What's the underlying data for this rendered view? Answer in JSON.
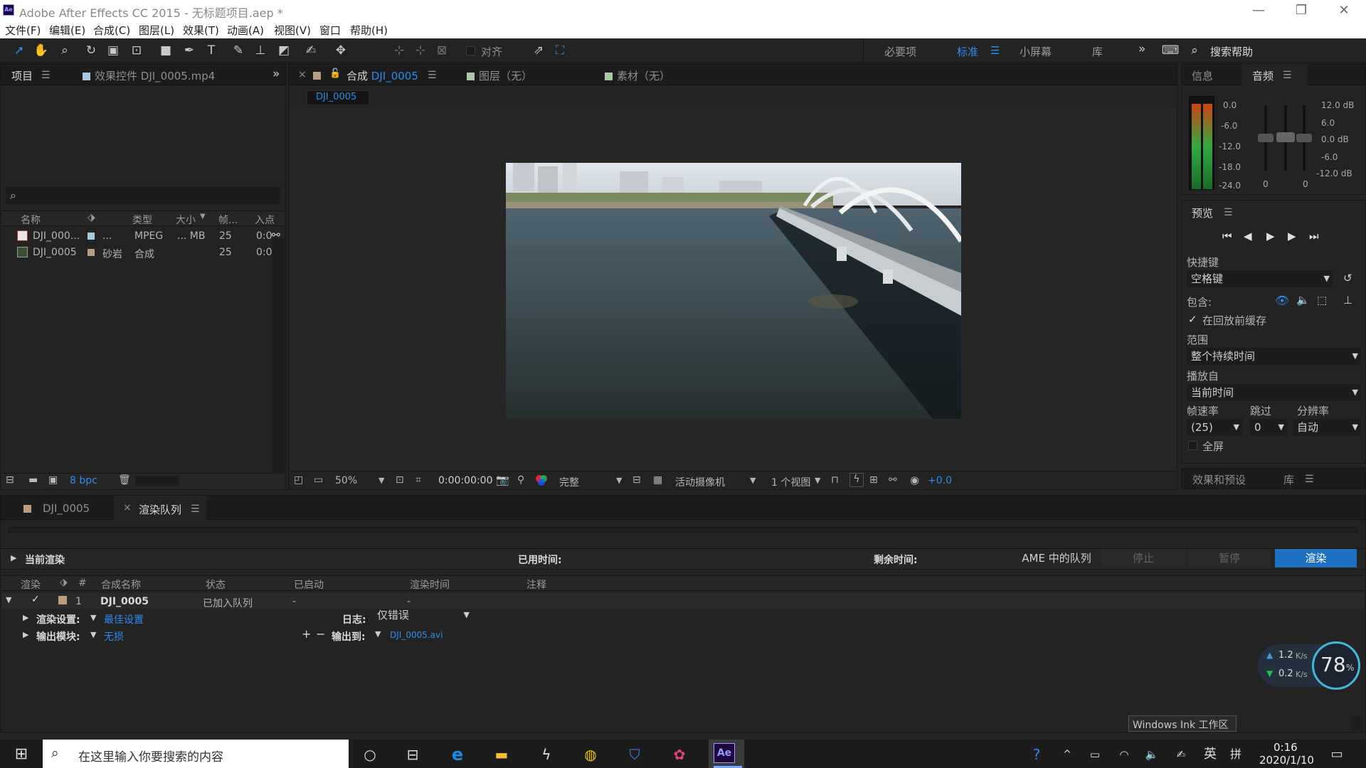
{
  "window": {
    "app_icon": "Ae",
    "title": "Adobe After Effects CC 2015 - 无标题项目.aep *",
    "minimize": "—",
    "restore": "❐",
    "close": "✕"
  },
  "menu": [
    "文件(F)",
    "编辑(E)",
    "合成(C)",
    "图层(L)",
    "效果(T)",
    "动画(A)",
    "视图(V)",
    "窗口",
    "帮助(H)"
  ],
  "toolbar": {
    "align_label": "对齐",
    "workspaces": [
      "必要项",
      "标准",
      "小屏幕",
      "库"
    ],
    "active_workspace": "标准",
    "overflow": "»",
    "search_help": "搜索帮助"
  },
  "project_panel": {
    "tab_project": "项目",
    "tab_effects": "效果控件 DJI_0005.mp4",
    "overflow": "»",
    "search_icon": "⌕",
    "columns": [
      "名称",
      "类型",
      "大小",
      "帧...",
      "入点"
    ],
    "rows": [
      {
        "name": "DJI_000...",
        "label": "...",
        "type": "MPEG",
        "size": "... MB",
        "fps": "25",
        "in": "0:0",
        "color": "#a7c9de"
      },
      {
        "name": "DJI_0005",
        "label": "砂岩",
        "type": "合成",
        "size": "",
        "fps": "25",
        "in": "0:0",
        "color": "#b89e7f"
      }
    ],
    "bpc": "8 bpc"
  },
  "viewer": {
    "close": "×",
    "tab_comp_prefix": "合成",
    "tab_comp_name": "DJI_0005",
    "tab_layer": "图层（无）",
    "tab_footage": "素材（无）",
    "breadcrumb": "DJI_0005",
    "zoom": "50%",
    "timecode": "0:00:00:00",
    "resolution": "完整",
    "camera": "活动摄像机",
    "views": "1 个视图",
    "exposure": "+0.0"
  },
  "audio_panel": {
    "tab_info": "信息",
    "tab_audio": "音频",
    "left_scale": [
      "0.0",
      "-6.0",
      "-12.0",
      "-18.0",
      "-24.0"
    ],
    "right_scale": [
      "12.0 dB",
      "6.0",
      "0.0 dB",
      "-6.0",
      "-12.0 dB"
    ],
    "slider_left_value": "0",
    "slider_right_value": "0"
  },
  "preview_panel": {
    "title": "预览",
    "shortcut_label": "快捷键",
    "shortcut_value": "空格键",
    "include_label": "包含:",
    "cache_label": "在回放前缓存",
    "range_label": "范围",
    "range_value": "整个持续时间",
    "play_from_label": "播放自",
    "play_from_value": "当前时间",
    "fps_label": "帧速率",
    "skip_label": "跳过",
    "res_label": "分辨率",
    "fps_value": "(25)",
    "skip_value": "0",
    "res_value": "自动",
    "fullscreen_label": "全屏"
  },
  "effects_panel": {
    "tab_effects": "效果和预设",
    "tab_library": "库"
  },
  "render_queue": {
    "tab_comp": "DJI_0005",
    "tab_close": "×",
    "tab_queue": "渲染队列",
    "current_render": "当前渲染",
    "elapsed_label": "已用时间:",
    "remaining_label": "剩余时间:",
    "ame_button": "AME 中的队列",
    "stop_button": "停止",
    "pause_button": "暂停",
    "render_button": "渲染",
    "columns": [
      "渲染",
      "#",
      "合成名称",
      "状态",
      "已启动",
      "渲染时间",
      "注释"
    ],
    "item": {
      "index": "1",
      "name": "DJI_0005",
      "status": "已加入队列",
      "started": "-",
      "render_time": "-"
    },
    "render_settings_label": "渲染设置:",
    "render_settings_value": "最佳设置",
    "log_label": "日志:",
    "log_value": "仅错误",
    "output_module_label": "输出模块:",
    "output_module_value": "无损",
    "output_to_label": "输出到:",
    "output_to_value": "DJI_0005.avi"
  },
  "network_widget": {
    "upload": "1.2",
    "download": "0.2",
    "unit": "K/s",
    "percent": "78",
    "percent_sign": "%"
  },
  "ink_tooltip": "Windows Ink 工作区",
  "taskbar": {
    "search_placeholder": "在这里输入你要搜索的内容",
    "ae_label": "Ae",
    "ime_lang": "英",
    "ime_mode": "拼",
    "time": "0:16",
    "date": "2020/1/10"
  }
}
